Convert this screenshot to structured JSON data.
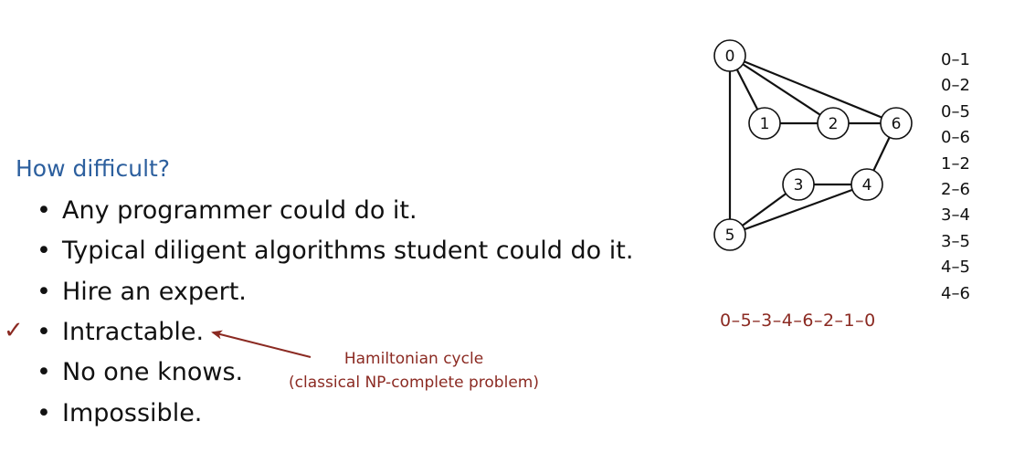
{
  "heading": "How difficult?",
  "bullets": [
    "Any programmer could do it.",
    "Typical diligent algorithms student could do it.",
    "Hire an expert.",
    "Intractable.",
    "No one knows.",
    "Impossible."
  ],
  "bullet_glyph": "•",
  "checked_index": 3,
  "check_glyph": "✓",
  "annotation": {
    "line1": "Hamiltonian cycle",
    "line2": "(classical NP-complete problem)"
  },
  "graph": {
    "nodes": [
      "0",
      "1",
      "2",
      "3",
      "4",
      "5",
      "6"
    ],
    "edges": [
      [
        "0",
        "1"
      ],
      [
        "0",
        "2"
      ],
      [
        "0",
        "5"
      ],
      [
        "0",
        "6"
      ],
      [
        "1",
        "2"
      ],
      [
        "2",
        "6"
      ],
      [
        "3",
        "4"
      ],
      [
        "3",
        "5"
      ],
      [
        "4",
        "5"
      ],
      [
        "4",
        "6"
      ]
    ]
  },
  "edge_list": [
    "0–1",
    "0–2",
    "0–5",
    "0–6",
    "1–2",
    "2–6",
    "3–4",
    "3–5",
    "4–5",
    "4–6"
  ],
  "cycle": "0–5–3–4–6–2–1–0",
  "colors": {
    "heading": "#2c5f9e",
    "accent": "#8b2a22",
    "text": "#111111"
  }
}
